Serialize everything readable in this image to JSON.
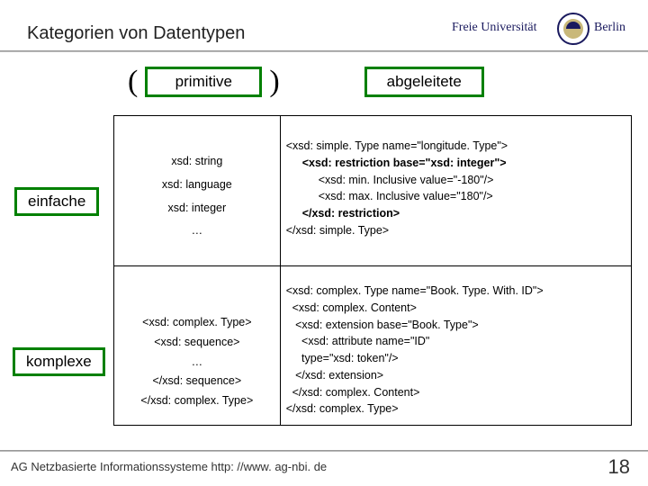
{
  "title": "Kategorien von Datentypen",
  "logo": {
    "text1": "Freie Universität",
    "text2": "Berlin"
  },
  "columns": {
    "primitive": "primitive",
    "derived": "abgeleitete"
  },
  "parens": {
    "open": "(",
    "close": ")"
  },
  "rows": {
    "simple": "einfache",
    "complex": "komplexe"
  },
  "cells": {
    "simple_primitive": {
      "l1": "xsd: string",
      "l2": "xsd: language",
      "l3": "xsd: integer",
      "l4": "…"
    },
    "simple_derived": {
      "l1a": "<xsd: simple. Type name=\"longitude. Type\">",
      "l2a": "<xsd: restriction base=\"xsd: integer\">",
      "l3a": "<xsd: min. Inclusive value=\"-180\"/>",
      "l4a": "<xsd: max. Inclusive value=\"180\"/>",
      "l5a": "</xsd: restriction>",
      "l6a": "</xsd: simple. Type>"
    },
    "complex_primitive": {
      "l1": "<xsd: complex. Type>",
      "l2": "<xsd: sequence>",
      "l3": "…",
      "l4": "</xsd: sequence>",
      "l5": "</xsd: complex. Type>"
    },
    "complex_derived": {
      "text": "<xsd: complex. Type name=\"Book. Type. With. ID\">\n  <xsd: complex. Content>\n   <xsd: extension base=\"Book. Type\">\n     <xsd: attribute name=\"ID\"\n     type=\"xsd: token\"/>\n   </xsd: extension>\n  </xsd: complex. Content>\n</xsd: complex. Type>"
    }
  },
  "footer": "AG Netzbasierte Informationssysteme http: //www. ag-nbi. de",
  "page": "18"
}
